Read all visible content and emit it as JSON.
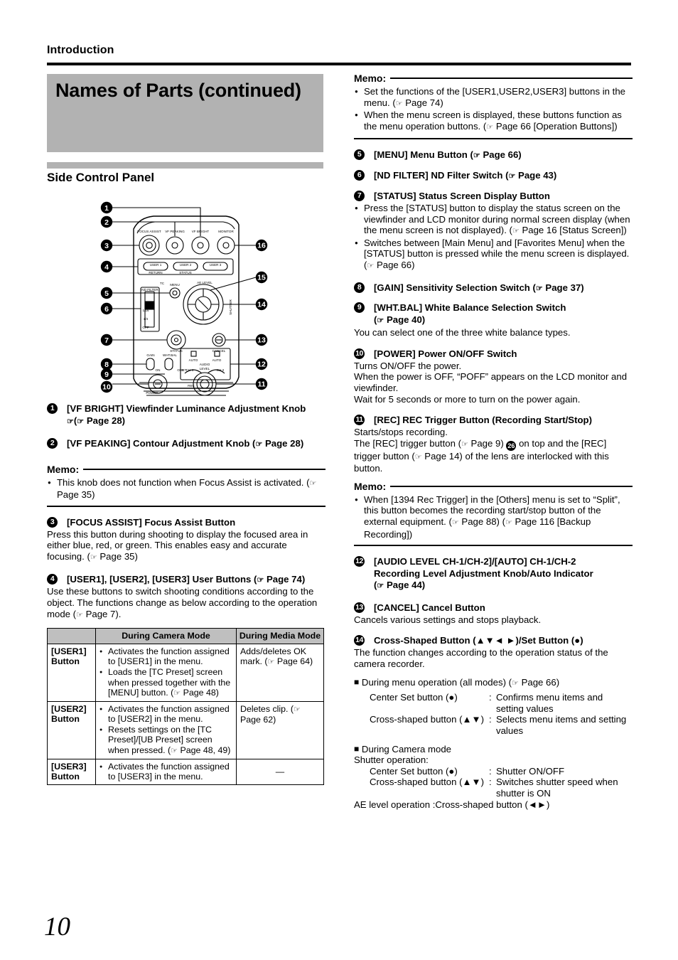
{
  "header": {
    "running_head": "Introduction",
    "title": "Names of Parts (continued)",
    "section_title": "Side Control Panel"
  },
  "folio": "10",
  "diagram": {
    "name": "side-control-panel-illustration",
    "knob_labels": [
      "FOCUS ASSIST",
      "VF PEAKING",
      "VF BRIGHT",
      "MONITOR"
    ],
    "user_buttons": [
      "USER 1",
      "USER 2",
      "USER 3"
    ],
    "user_sub_labels": [
      "RETURN",
      "STATUS"
    ],
    "nd_filter_positions": [
      "ND FILTER",
      "1/16",
      "1/4",
      "OFF"
    ],
    "other_labels": [
      "TC",
      "MENU",
      "AE LEVEL",
      "STATUS",
      "CANCEL",
      "GAIN",
      "WHT.BAL",
      "AUTO",
      "AUDIO LEVEL",
      "CH-1",
      "CH-2",
      "SET",
      "ON",
      "OFF",
      "POWER",
      "REC",
      "SHUTTER"
    ],
    "callouts": [
      "1",
      "2",
      "3",
      "4",
      "5",
      "6",
      "7",
      "8",
      "9",
      "10",
      "11",
      "12",
      "13",
      "14",
      "15",
      "16"
    ]
  },
  "left_column": {
    "item1": {
      "num": "1",
      "label": "[VF BRIGHT] Viewfinder Luminance Adjustment Knob",
      "label_line2": "( Page 28)"
    },
    "item2": {
      "num": "2",
      "label": "[VF PEAKING] Contour Adjustment Knob ( Page 28)"
    },
    "memo1": {
      "word": "Memo:",
      "bullets": [
        "This knob does not function when Focus Assist is activated. ( Page 35)"
      ]
    },
    "item3": {
      "num": "3",
      "label": "[FOCUS ASSIST] Focus Assist Button",
      "body": "Press this button during shooting to display the focused area in either blue, red, or green. This enables easy and accurate focusing. ( Page 35)"
    },
    "item4": {
      "num": "4",
      "label": "[USER1], [USER2], [USER3] User Buttons ( Page 74)",
      "body": "Use these buttons to switch shooting conditions according to the object. The functions change as below according to the operation mode ( Page 7)."
    },
    "table": {
      "headers": [
        "",
        "During Camera Mode",
        "During Media Mode"
      ],
      "rows": [
        {
          "name": "[USER1] Button",
          "camera": [
            "Activates the function assigned to [USER1] in the menu.",
            "Loads the [TC Preset] screen when pressed together with the [MENU] button. ( Page 48)"
          ],
          "media": "Adds/deletes OK mark. ( Page 64)"
        },
        {
          "name": "[USER2] Button",
          "camera": [
            "Activates the function assigned to [USER2] in the menu.",
            "Resets settings on the [TC Preset]/[UB Preset] screen when pressed. ( Page 48, 49)"
          ],
          "media": "Deletes clip. ( Page 62)"
        },
        {
          "name": "[USER3] Button",
          "camera": [
            "Activates the function assigned to [USER3] in the menu."
          ],
          "media": "—"
        }
      ]
    }
  },
  "right_column": {
    "memo_top": {
      "word": "Memo:",
      "bullets": [
        "Set the functions of the [USER1,USER2,USER3] buttons in the menu. ( Page 74)",
        "When the menu screen is displayed, these buttons function as the menu operation buttons. ( Page 66 [Operation Buttons])"
      ]
    },
    "item5": {
      "num": "5",
      "label": "[MENU] Menu Button ( Page 66)"
    },
    "item6": {
      "num": "6",
      "label": "[ND FILTER] ND Filter Switch ( Page 43)"
    },
    "item7": {
      "num": "7",
      "label": "[STATUS] Status Screen Display Button",
      "bullets": [
        "Press the [STATUS] button to display the status screen on the viewfinder and LCD monitor during normal screen display (when the menu screen is not displayed). ( Page 16 [Status Screen])",
        "Switches between [Main Menu] and [Favorites Menu] when the [STATUS] button is pressed while the menu screen is displayed. ( Page 66)"
      ]
    },
    "item8": {
      "num": "8",
      "label": "[GAIN] Sensitivity Selection Switch ( Page 37)"
    },
    "item9": {
      "num": "9",
      "label": "[WHT.BAL] White Balance Selection Switch",
      "label_line2": "( Page 40)",
      "body": "You can select one of the three white balance types."
    },
    "item10": {
      "num": "10",
      "label": "[POWER] Power ON/OFF Switch",
      "body_lines": [
        "Turns ON/OFF the power.",
        "When the power is OFF, “POFF” appears on the LCD monitor and viewfinder.",
        "Wait for 5 seconds or more to turn on the power again."
      ]
    },
    "item11": {
      "num": "11",
      "label": "[REC] REC Trigger Button (Recording Start/Stop)",
      "body_pre": "Starts/stops recording.",
      "body_a": "The [REC] trigger button ( Page 9) ",
      "inline_num": "26",
      "body_b": " on top and the [REC] trigger button ( Page 14) of the lens are interlocked with this button."
    },
    "memo_rec": {
      "word": "Memo:",
      "bullets": [
        "When [1394 Rec Trigger] in the [Others] menu is set to “Split”, this button becomes the recording start/stop button of the external equipment. ( Page 88) ( Page 116 [Backup Recording])"
      ]
    },
    "item12": {
      "num": "12",
      "label": "[AUDIO LEVEL CH-1/CH-2]/[AUTO] CH-1/CH-2",
      "label_line2": "Recording Level Adjustment Knob/Auto Indicator",
      "label_line3": "( Page 44)"
    },
    "item13": {
      "num": "13",
      "label": "[CANCEL] Cancel Button",
      "body": "Cancels various settings and stops playback."
    },
    "item14": {
      "num": "14",
      "label": "Cross-Shaped Button (▲▼◄ ►)/Set Button (●)",
      "body": "The function changes according to the operation status of the camera recorder.",
      "sub1_heading": "During menu operation (all modes) ( Page 66)",
      "sub1_rows": [
        {
          "key": "Center Set button (●)",
          "value": "Confirms menu items and setting values"
        },
        {
          "key": "Cross-shaped button (▲▼)",
          "value": "Selects menu items and setting values"
        }
      ],
      "sub2_heading": "During Camera mode",
      "sub2_intro": "Shutter operation:",
      "sub2_rows": [
        {
          "key": "Center Set button (●)",
          "value": "Shutter ON/OFF"
        },
        {
          "key": "Cross-shaped button (▲▼)",
          "value": "Switches shutter speed when shutter is ON"
        }
      ],
      "ae_line": "AE level operation :Cross-shaped button (◄►)"
    }
  }
}
